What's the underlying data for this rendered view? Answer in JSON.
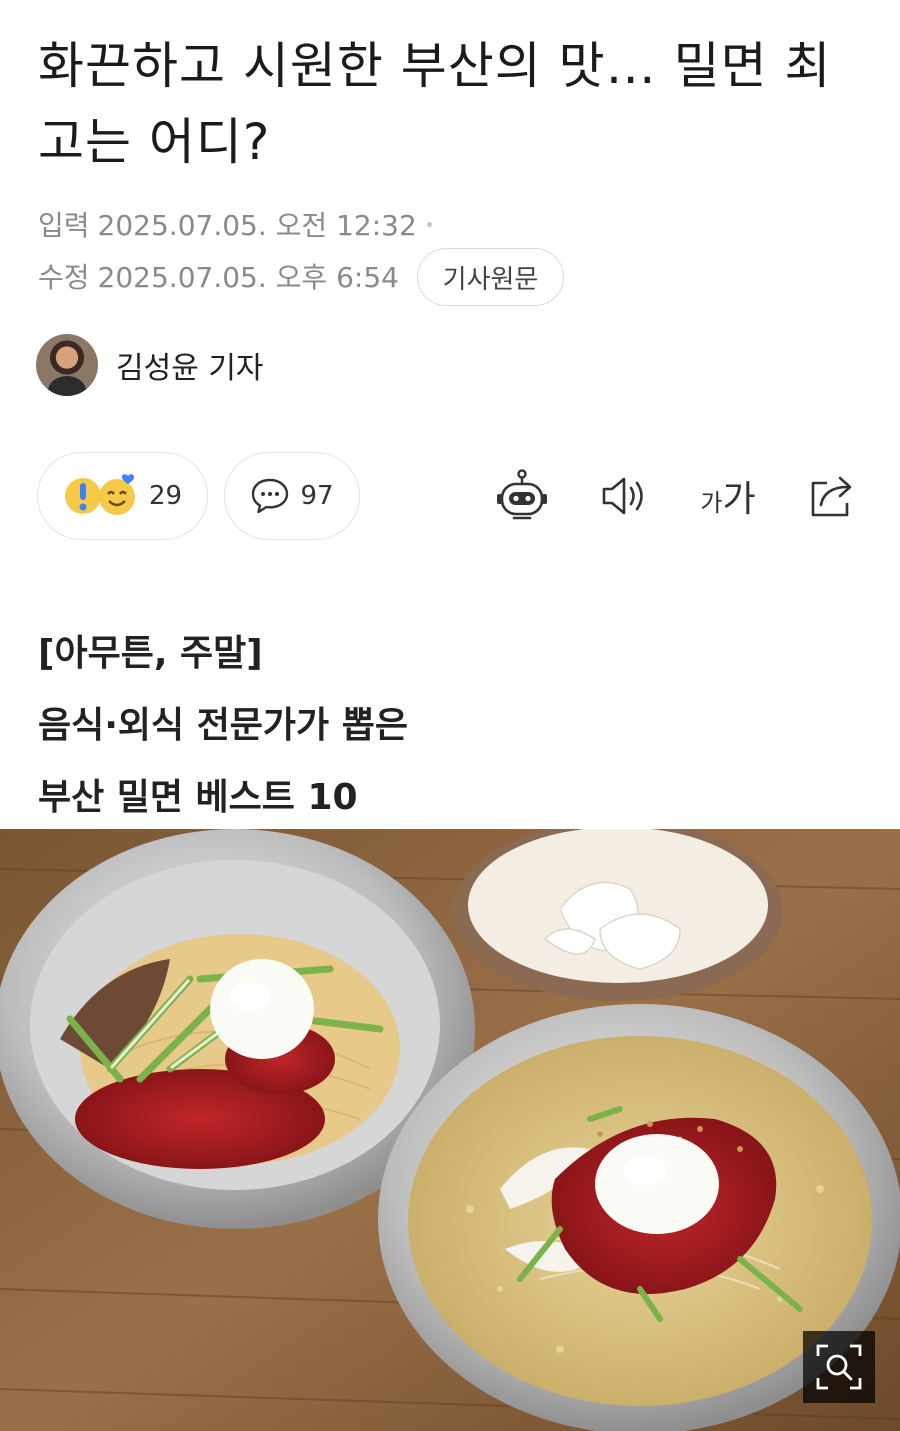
{
  "article": {
    "headline": "화끈하고 시원한 부산의 맛… 밀면 최고는 어디?",
    "published_label": "입력",
    "published": "2025.07.05. 오전 12:32",
    "modified_label": "수정",
    "modified": "2025.07.05. 오후 6:54",
    "original_button": "기사원문"
  },
  "reporter": {
    "name": "김성윤 기자"
  },
  "engagement": {
    "reactions_count": "29",
    "comments_count": "97"
  },
  "toolbar": {
    "icons": [
      "robot-icon",
      "speaker-icon",
      "font-size-icon",
      "share-icon"
    ],
    "font_small": "가",
    "font_big": "가"
  },
  "subhead": {
    "line1": "[아무튼, 주말]",
    "line2": "음식·외식 전문가가 뽑은",
    "line3": "부산 밀면 베스트 10"
  },
  "colors": {
    "text": "#1b1b1b",
    "meta": "#8a8a8a",
    "border": "#e3e3e3",
    "emoji_yellow": "#f7c948",
    "emoji_blue": "#3b82f6"
  }
}
